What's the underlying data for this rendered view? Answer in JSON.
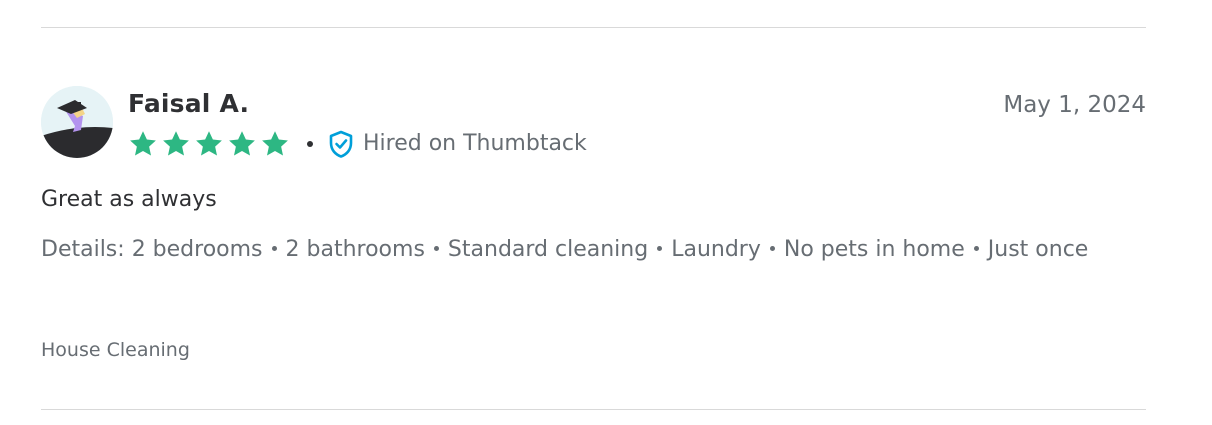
{
  "review": {
    "reviewer_name": "Faisal A.",
    "date": "May 1, 2024",
    "rating": 5,
    "rating_max": 5,
    "hired_badge": "Hired on Thumbtack",
    "text": "Great as always",
    "details_label": "Details:",
    "details": [
      "2 bedrooms",
      "2 bathrooms",
      "Standard cleaning",
      "Laundry",
      "No pets in home",
      "Just once"
    ],
    "category": "House Cleaning"
  },
  "colors": {
    "star": "#2db783",
    "badge_blue": "#009fd9",
    "text_primary": "#2f3033",
    "text_secondary": "#676d73",
    "divider": "#d9d9d9"
  },
  "icons": {
    "star": "star-icon",
    "badge": "shield-check-icon",
    "avatar": "avatar-illustration"
  }
}
